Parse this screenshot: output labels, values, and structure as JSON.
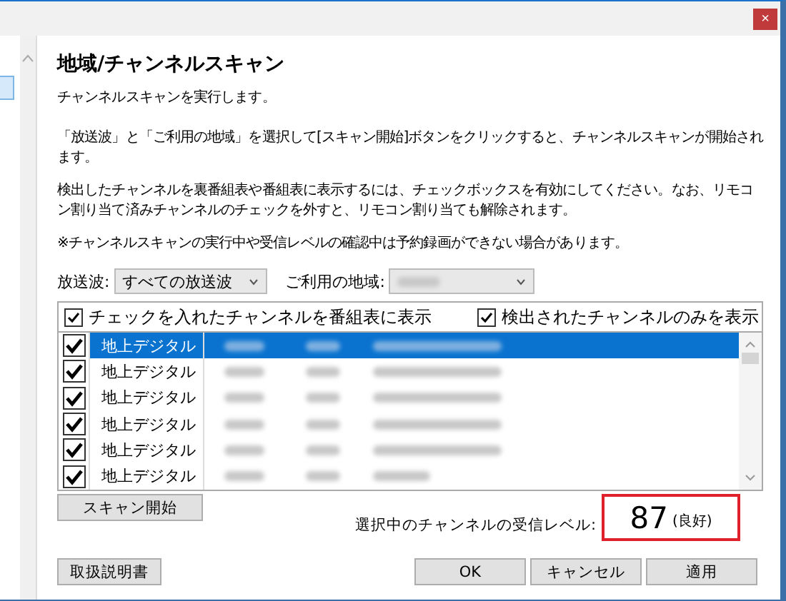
{
  "window": {
    "close_label": "×"
  },
  "heading": "地域/チャンネルスキャン",
  "intro": "チャンネルスキャンを実行します。",
  "paragraphs": [
    "「放送波」と「ご利用の地域」を選択して[スキャン開始]ボタンをクリックすると、チャンネルスキャンが開始されます。",
    "検出したチャンネルを裏番組表や番組表に表示するには、チェックボックスを有効にしてください。なお、リモコン割り当て済みチャンネルのチェックを外すと、リモコン割り当ても解除されます。",
    "※チャンネルスキャンの実行中や受信レベルの確認中は予約録画ができない場合があります。"
  ],
  "filters": [
    {
      "label": "放送波:",
      "value": "すべての放送波"
    },
    {
      "label": "ご利用の地域:"
    }
  ],
  "list_options": [
    {
      "label": "チェックを入れたチャンネルを番組表に表示",
      "checked": true
    },
    {
      "label": "検出されたチャンネルのみを表示",
      "checked": true
    }
  ],
  "channels": [
    {
      "type": "地上デジタル",
      "checked": true,
      "selected": true
    },
    {
      "type": "地上デジタル",
      "checked": true,
      "selected": false
    },
    {
      "type": "地上デジタル",
      "checked": true,
      "selected": false
    },
    {
      "type": "地上デジタル",
      "checked": true,
      "selected": false
    },
    {
      "type": "地上デジタル",
      "checked": true,
      "selected": false
    },
    {
      "type": "地上デジタル",
      "checked": true,
      "selected": false
    }
  ],
  "scan_button": "スキャン開始",
  "level_label": "選択中のチャンネルの受信レベル:",
  "level_value": "87",
  "level_status": "(良好)",
  "manual_button": "取扱説明書",
  "buttons": [
    "OK",
    "キャンセル",
    "適用"
  ]
}
